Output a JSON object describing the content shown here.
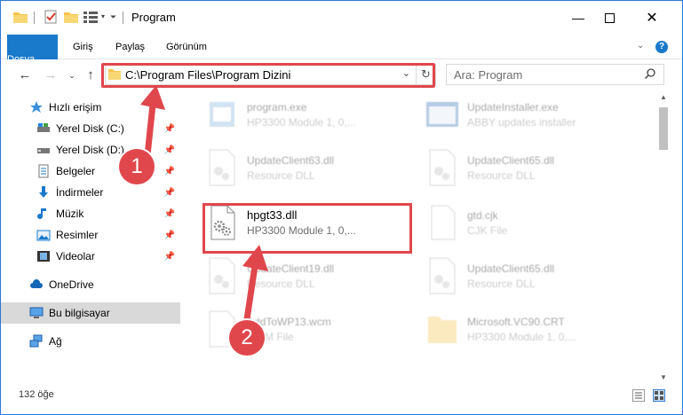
{
  "window": {
    "title": "Program"
  },
  "ribbon": {
    "tabs": [
      "Dosya",
      "Giriş",
      "Paylaş",
      "Görünüm"
    ]
  },
  "address": {
    "path": "C:\\Program Files\\Program Dizini",
    "search_placeholder": "Ara: Program"
  },
  "sidebar": {
    "items": [
      {
        "label": "Hızlı erişim",
        "icon": "star-icon"
      },
      {
        "label": "Yerel Disk (C:)",
        "icon": "drive-icon",
        "pinned": true
      },
      {
        "label": "Yerel Disk (D:)",
        "icon": "drive-icon",
        "pinned": true
      },
      {
        "label": "Belgeler",
        "icon": "documents-icon",
        "pinned": true
      },
      {
        "label": "İndirmeler",
        "icon": "download-icon",
        "pinned": true
      },
      {
        "label": "Müzik",
        "icon": "music-icon",
        "pinned": true
      },
      {
        "label": "Resimler",
        "icon": "pictures-icon",
        "pinned": true
      },
      {
        "label": "Videolar",
        "icon": "videos-icon",
        "pinned": true
      },
      {
        "label": "OneDrive",
        "icon": "cloud-icon"
      },
      {
        "label": "Bu bilgisayar",
        "icon": "computer-icon",
        "selected": true
      },
      {
        "label": "Ağ",
        "icon": "network-icon"
      }
    ]
  },
  "files": [
    {
      "name": "program.exe",
      "desc": "HP3300 Module 1, 0,...",
      "icon": "exe-icon"
    },
    {
      "name": "UpdateInstaller.exe",
      "desc": "ABBY updates installer",
      "icon": "installer-icon"
    },
    {
      "name": "UpdateClient63.dll",
      "desc": "Resource DLL",
      "icon": "dll-icon"
    },
    {
      "name": "UpdateClient65.dll",
      "desc": "Resource DLL",
      "icon": "dll-icon"
    },
    {
      "name": "hpgt33.dll",
      "desc": "HP3300 Module 1, 0,...",
      "icon": "dll-icon"
    },
    {
      "name": "gtd.cjk",
      "desc": "CJK File",
      "icon": "file-icon"
    },
    {
      "name": "UpdateClient19.dll",
      "desc": "Resource DLL",
      "icon": "dll-icon"
    },
    {
      "name": "UpdateClient65.dll",
      "desc": "Resource DLL",
      "icon": "dll-icon"
    },
    {
      "name": "AddToWP13.wcm",
      "desc": "WCM File",
      "icon": "file-icon"
    },
    {
      "name": "Microsoft.VC90.CRT",
      "desc": "HP3300 Module 1, 0,...",
      "icon": "folder-icon"
    }
  ],
  "status": {
    "count": "132 öğe"
  },
  "annotations": {
    "step1": "1",
    "step2": "2",
    "color": "#e0474c"
  },
  "colors": {
    "accent": "#1979ca",
    "highlight": "#e0474c",
    "folder": "#f6c44c"
  }
}
